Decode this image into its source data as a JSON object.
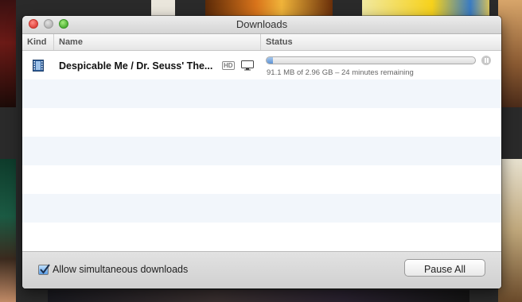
{
  "window": {
    "title": "Downloads"
  },
  "columns": {
    "kind": "Kind",
    "name": "Name",
    "status": "Status"
  },
  "downloads": [
    {
      "kind_icon": "film-icon",
      "name": "Despicable Me / Dr. Seuss' The...",
      "badge": "HD",
      "device_icon": "computer-icon",
      "progress_fraction": 0.03,
      "status_text": "91.1 MB of 2.96 GB – 24 minutes remaining",
      "action_icon": "pause-icon"
    }
  ],
  "footer": {
    "simultaneous_label": "Allow simultaneous downloads",
    "simultaneous_checked": true,
    "pause_all_label": "Pause All"
  },
  "colors": {
    "progress": "#5d92d4",
    "close": "#e0443e",
    "zoom": "#4fb136"
  }
}
